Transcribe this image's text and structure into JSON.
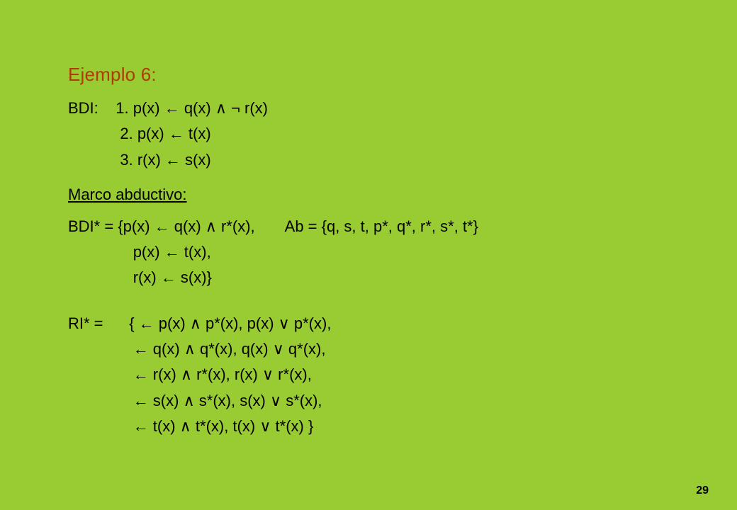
{
  "page_number": "29",
  "title": "Ejemplo 6:",
  "bdi_label": "BDI:",
  "bdi_pad": "        ",
  "bdi_lines": [
    "1. p(x) ← q(x) ∧ ¬ r(x)",
    "2. p(x) ← t(x)",
    "3. r(x) ← s(x)"
  ],
  "marco_label": "Marco abductivo:",
  "bdistar_left_first": "BDI* = {p(x) ← q(x) ∧ r*(x),",
  "ab_text": "Ab = {q, s, t, p*, q*, r*, s*, t*}",
  "bdistar_pad": "               ",
  "bdistar_lines": [
    "p(x) ← t(x),",
    "r(x) ← s(x)}"
  ],
  "ri_first": "RI* =      { ← p(x) ∧ p*(x), p(x) ∨ p*(x),",
  "ri_pad": "               ",
  "ri_lines": [
    "← q(x) ∧ q*(x), q(x) ∨ q*(x),",
    "← r(x) ∧ r*(x), r(x) ∨ r*(x),",
    "← s(x) ∧ s*(x), s(x) ∨ s*(x),",
    "← t(x) ∧ t*(x), t(x) ∨ t*(x) }"
  ]
}
